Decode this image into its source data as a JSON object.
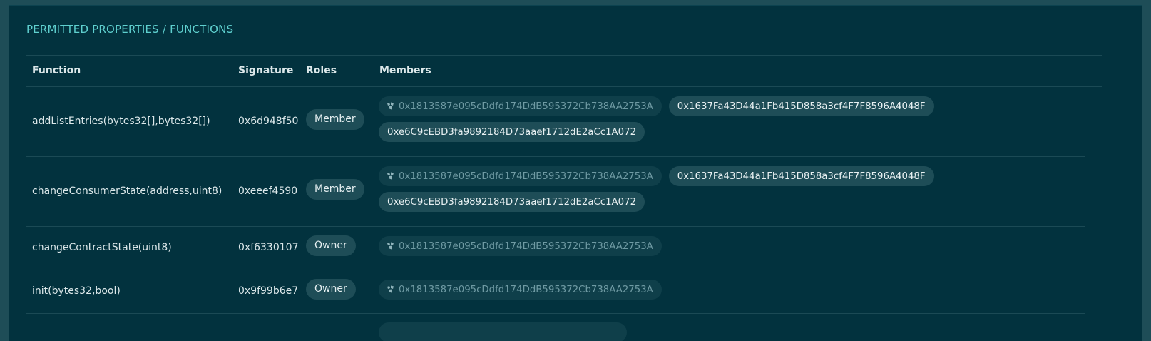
{
  "section_title": "PERMITTED PROPERTIES / FUNCTIONS",
  "columns": {
    "function": "Function",
    "signature": "Signature",
    "roles": "Roles",
    "members": "Members"
  },
  "rows": [
    {
      "function": "addListEntries(bytes32[],bytes32[])",
      "signature": "0x6d948f50",
      "role": "Member",
      "members": [
        {
          "address": "0x1813587e095cDdfd174DdB595372Cb738AA2753A",
          "muted": true,
          "icon": "contract-icon"
        },
        {
          "address": "0x1637Fa43D44a1Fb415D858a3cf4F7F8596A4048F",
          "muted": false
        },
        {
          "address": "0xe6C9cEBD3fa9892184D73aaef1712dE2aCc1A072",
          "muted": false
        }
      ]
    },
    {
      "function": "changeConsumerState(address,uint8)",
      "signature": "0xeeef4590",
      "role": "Member",
      "members": [
        {
          "address": "0x1813587e095cDdfd174DdB595372Cb738AA2753A",
          "muted": true,
          "icon": "contract-icon"
        },
        {
          "address": "0x1637Fa43D44a1Fb415D858a3cf4F7F8596A4048F",
          "muted": false
        },
        {
          "address": "0xe6C9cEBD3fa9892184D73aaef1712dE2aCc1A072",
          "muted": false
        }
      ]
    },
    {
      "function": "changeContractState(uint8)",
      "signature": "0xf6330107",
      "role": "Owner",
      "members": [
        {
          "address": "0x1813587e095cDdfd174DdB595372Cb738AA2753A",
          "muted": true,
          "icon": "contract-icon"
        }
      ]
    },
    {
      "function": "init(bytes32,bool)",
      "signature": "0x9f99b6e7",
      "role": "Owner",
      "members": [
        {
          "address": "0x1813587e095cDdfd174DdB595372Cb738AA2753A",
          "muted": true,
          "icon": "contract-icon"
        }
      ]
    }
  ],
  "colors": {
    "background": "#1e4d57",
    "panel": "#02323e",
    "title_accent": "#5fd0cf",
    "pill": "#1e4d57",
    "pill_muted": "#0f3f4a"
  }
}
